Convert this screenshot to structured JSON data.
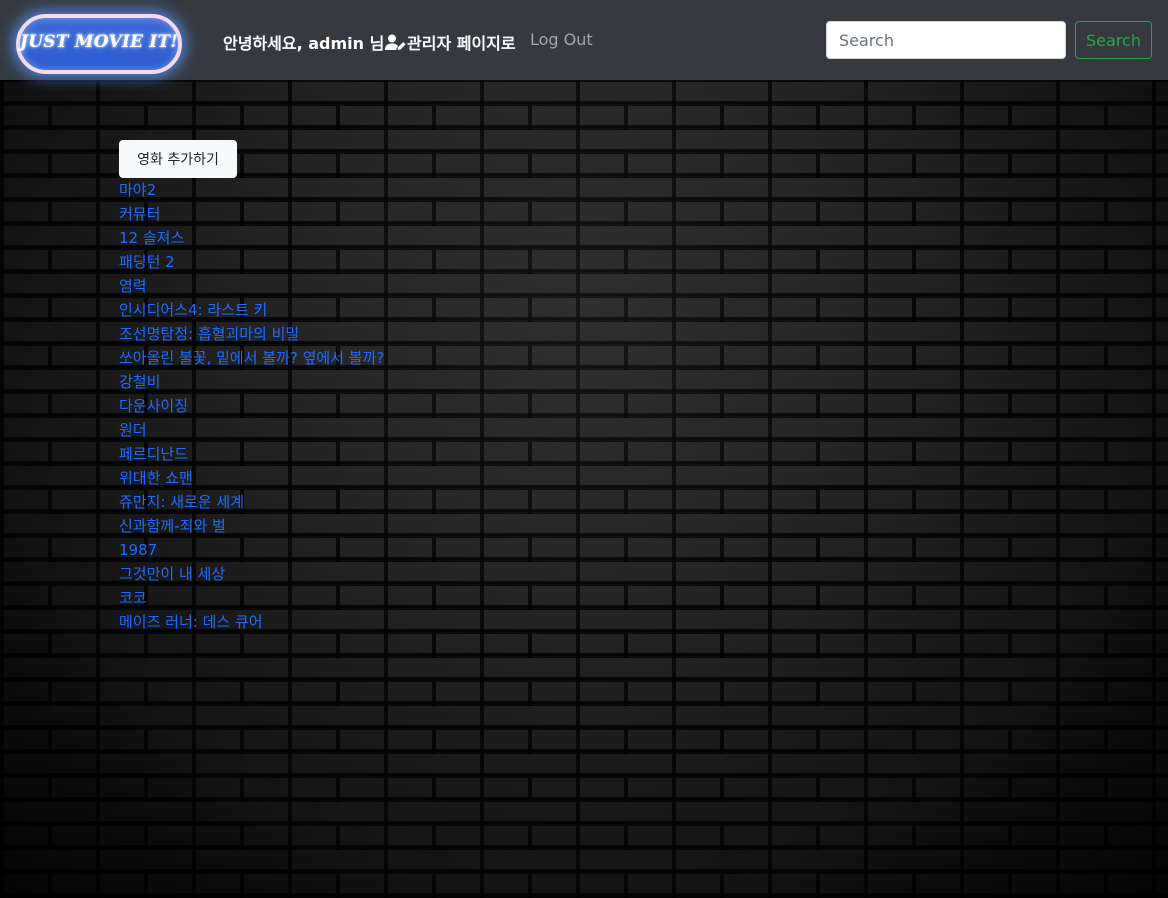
{
  "navbar": {
    "brand": "JUST MOVIE IT!",
    "greeting": "안녕하세요, admin 님",
    "admin_link": "관리자 페이지로",
    "logout": "Log Out",
    "search_placeholder": "Search",
    "search_button": "Search",
    "user_icon": "user-edit-icon"
  },
  "main": {
    "add_movie_button": "영화 추가하기",
    "movies": [
      "마야2",
      "커뮤터",
      "12 솔져스",
      "패딩턴 2",
      "염력",
      "인시디어스4: 라스트 키",
      "조선명탐정: 흡혈괴마의 비밀",
      "쏘아올린 불꽃, 밑에서 볼까? 옆에서 볼까?",
      "강철비",
      "다운사이징",
      "원더",
      "페르디난드",
      "위대한 쇼맨",
      "쥬만지: 새로운 세계",
      "신과함께-죄와 벌",
      "1987",
      "그것만이 내 세상",
      "코코",
      "메이즈 러너: 데스 큐어"
    ]
  },
  "colors": {
    "navbar_bg": "#343a40",
    "link": "#1f6bff",
    "search_accent": "#28a745",
    "brand_glow": "#5a96ff"
  }
}
